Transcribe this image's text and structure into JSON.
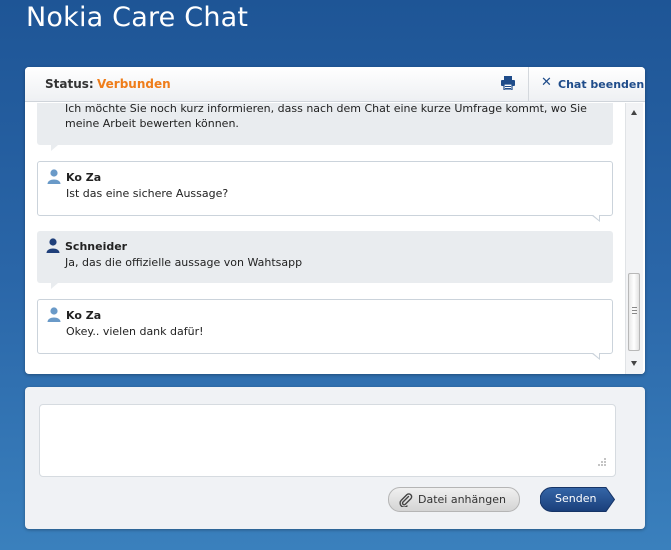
{
  "app": {
    "title": "Nokia Care Chat"
  },
  "status_bar": {
    "label": "Status:",
    "value": "Verbunden",
    "value_color": "#ef7d1a",
    "print_icon": "printer-icon",
    "end_chat_icon": "close-icon",
    "end_chat_label": "Chat beenden"
  },
  "messages": [
    {
      "role": "agent",
      "sender": "",
      "lines": [
        "Ich möchte Sie noch kurz informieren, dass nach dem Chat eine kurze Umfrage kommt, wo Sie",
        "meine Arbeit bewerten können."
      ]
    },
    {
      "role": "user",
      "sender": "Ko Za",
      "lines": [
        "Ist das eine sichere Aussage?"
      ]
    },
    {
      "role": "agent",
      "sender": "Schneider",
      "lines": [
        "Ja, das die offizielle aussage von Wahtsapp"
      ]
    },
    {
      "role": "user",
      "sender": "Ko Za",
      "lines": [
        "Okey.. vielen dank dafür!"
      ]
    }
  ],
  "composer": {
    "input_value": "",
    "attach_icon": "paperclip-icon",
    "attach_label": "Datei anhängen",
    "send_label": "Senden"
  },
  "colors": {
    "accent": "#1f4c8a",
    "send_button": "#1f4c8a",
    "background": "#2a66a8"
  }
}
